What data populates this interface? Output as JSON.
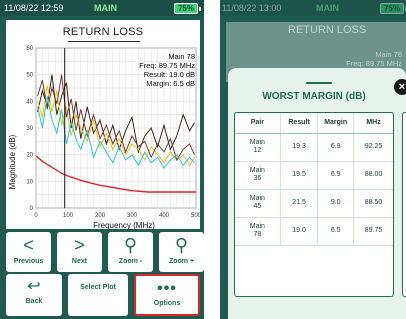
{
  "left": {
    "status": {
      "time": "11/08/22 12:59",
      "title": "MAIN",
      "battery": "75%"
    },
    "screen_title": "RETURN LOSS",
    "readout": {
      "pair": "Main 78",
      "freq": "Freq: 89.75 MHz",
      "result": "Result: 19.0 dB",
      "margin": "Margin: 6.5 dB"
    },
    "chart_data": {
      "type": "line",
      "title": "RETURN LOSS",
      "xlabel": "Frequency (MHz)",
      "ylabel": "Magnitude (dB)",
      "xlim": [
        0,
        500
      ],
      "ylim": [
        0,
        60
      ],
      "x_ticks": [
        "0",
        "100",
        "200",
        "300",
        "400",
        "500"
      ],
      "y_ticks": [
        "0",
        "10",
        "20",
        "30",
        "40",
        "50",
        "60"
      ],
      "grid": true,
      "cursor_x": 89.75,
      "limit_line": {
        "x": [
          1,
          20,
          40,
          60,
          80,
          100,
          150,
          200,
          250,
          300,
          350,
          400,
          450,
          500
        ],
        "y": [
          19.5,
          17.5,
          16,
          14.5,
          13,
          12,
          10,
          8.5,
          7.5,
          6.5,
          6,
          6,
          6,
          6
        ]
      },
      "series": [
        {
          "color": "#3d2418",
          "x": [
            5,
            20,
            35,
            50,
            65,
            80,
            95,
            110,
            125,
            140,
            160,
            180,
            200,
            220,
            240,
            260,
            280,
            300,
            320,
            340,
            360,
            380,
            400,
            420,
            440,
            460,
            480,
            495
          ],
          "y": [
            36,
            44,
            38,
            50,
            35,
            42,
            47,
            30,
            40,
            26,
            38,
            28,
            33,
            24,
            31,
            22,
            29,
            34,
            21,
            27,
            30,
            23,
            31,
            22,
            27,
            35,
            29,
            32
          ]
        },
        {
          "color": "#e8c51a",
          "x": [
            5,
            20,
            35,
            50,
            65,
            80,
            95,
            110,
            125,
            140,
            160,
            180,
            200,
            220,
            240,
            260,
            280,
            300,
            320,
            340,
            360,
            380,
            400,
            420,
            440,
            460,
            480,
            495
          ],
          "y": [
            40,
            34,
            46,
            36,
            44,
            31,
            38,
            27,
            35,
            30,
            25,
            33,
            23,
            28,
            22,
            26,
            20,
            24,
            22,
            18,
            23,
            20,
            17,
            21,
            18,
            20,
            16,
            19
          ]
        },
        {
          "color": "#7a3a3a",
          "x": [
            5,
            20,
            35,
            50,
            65,
            80,
            95,
            110,
            125,
            140,
            160,
            180,
            200,
            220,
            240,
            260,
            280,
            300,
            320,
            340,
            360,
            380,
            400,
            420,
            440,
            460,
            480,
            495
          ],
          "y": [
            42,
            48,
            37,
            45,
            39,
            50,
            34,
            41,
            29,
            37,
            27,
            35,
            26,
            31,
            24,
            29,
            21,
            27,
            23,
            25,
            19,
            24,
            21,
            26,
            18,
            22,
            24,
            20
          ]
        },
        {
          "color": "#2ec4d6",
          "x": [
            5,
            20,
            35,
            50,
            65,
            80,
            95,
            110,
            125,
            140,
            160,
            180,
            200,
            220,
            240,
            260,
            280,
            300,
            320,
            340,
            360,
            380,
            400,
            420,
            440,
            460,
            480,
            495
          ],
          "y": [
            38,
            30,
            42,
            33,
            28,
            37,
            24,
            32,
            26,
            22,
            29,
            19,
            25,
            21,
            17,
            23,
            18,
            20,
            16,
            21,
            17,
            19,
            15,
            18,
            20,
            16,
            19,
            17
          ]
        }
      ]
    },
    "buttons_row1": [
      {
        "icon": "<",
        "label": "Previous"
      },
      {
        "icon": ">",
        "label": "Next"
      },
      {
        "icon": "⚲",
        "label": "Zoom -"
      },
      {
        "icon": "⚲",
        "label": "Zoom +"
      }
    ],
    "buttons_row2": [
      {
        "icon": "↩",
        "label": "Back"
      },
      {
        "label": "Select Plot"
      },
      {
        "icon": "•••",
        "label": "Options"
      }
    ]
  },
  "right": {
    "status": {
      "time": "11/08/22 13:00",
      "title": "MAIN",
      "battery": "75%"
    },
    "bg_title": "RETURN LOSS",
    "bg_readout": {
      "pair": "Main 78",
      "freq": "Freq: 89.75 MHz"
    },
    "sheet": {
      "title": "WORST MARGIN (dB)",
      "close_icon": "×",
      "columns": [
        "Pair",
        "Result",
        "Margin",
        "MHz"
      ],
      "rows": [
        {
          "pair": "Main 12",
          "result": "19.3",
          "margin": "6.9",
          "mhz": "92.25"
        },
        {
          "pair": "Main 36",
          "result": "19.5",
          "margin": "6.9",
          "mhz": "88.00"
        },
        {
          "pair": "Main 45",
          "result": "21.5",
          "margin": "9.0",
          "mhz": "88.50"
        },
        {
          "pair": "Main 78",
          "result": "19.0",
          "margin": "6.5",
          "mhz": "89.75"
        }
      ]
    }
  }
}
